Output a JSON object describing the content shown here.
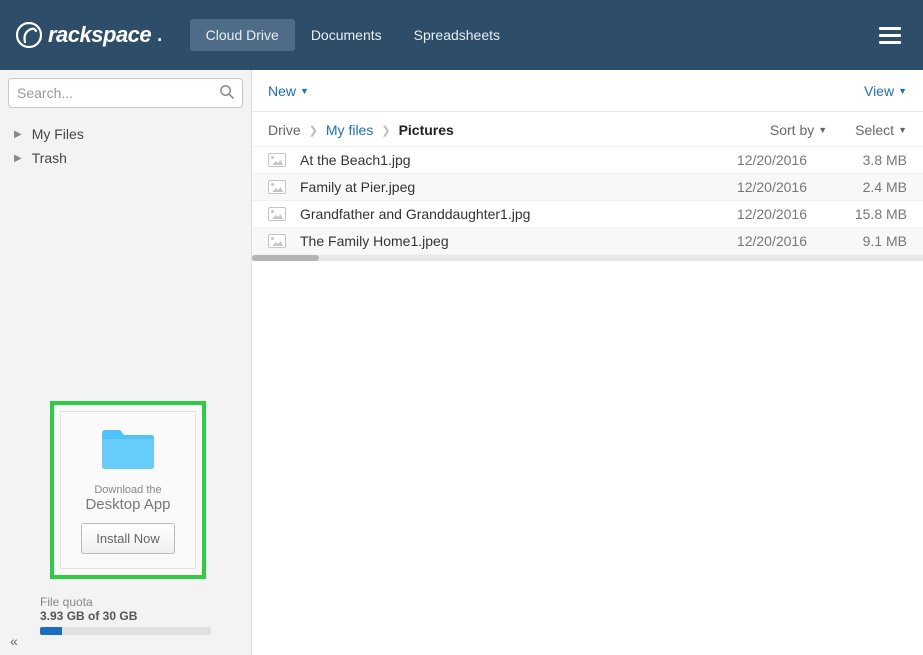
{
  "brand": "rackspace",
  "nav": {
    "items": [
      {
        "label": "Cloud Drive",
        "active": true
      },
      {
        "label": "Documents",
        "active": false
      },
      {
        "label": "Spreadsheets",
        "active": false
      }
    ]
  },
  "search": {
    "placeholder": "Search..."
  },
  "tree": {
    "items": [
      {
        "label": "My Files"
      },
      {
        "label": "Trash"
      }
    ]
  },
  "promo": {
    "line1": "Download the",
    "line2": "Desktop App",
    "button": "Install Now"
  },
  "quota": {
    "label": "File quota",
    "text": "3.93 GB of 30 GB",
    "percent": 13
  },
  "toolbar": {
    "new_label": "New",
    "view_label": "View"
  },
  "breadcrumbs": {
    "items": [
      {
        "label": "Drive",
        "link": false
      },
      {
        "label": "My files",
        "link": true
      },
      {
        "label": "Pictures",
        "current": true
      }
    ],
    "sort_label": "Sort by",
    "select_label": "Select"
  },
  "files": [
    {
      "name": "At the Beach1.jpg",
      "date": "12/20/2016",
      "size": "3.8 MB"
    },
    {
      "name": "Family at Pier.jpeg",
      "date": "12/20/2016",
      "size": "2.4 MB"
    },
    {
      "name": "Grandfather and Granddaughter1.jpg",
      "date": "12/20/2016",
      "size": "15.8 MB"
    },
    {
      "name": "The Family Home1.jpeg",
      "date": "12/20/2016",
      "size": "9.1 MB"
    }
  ]
}
